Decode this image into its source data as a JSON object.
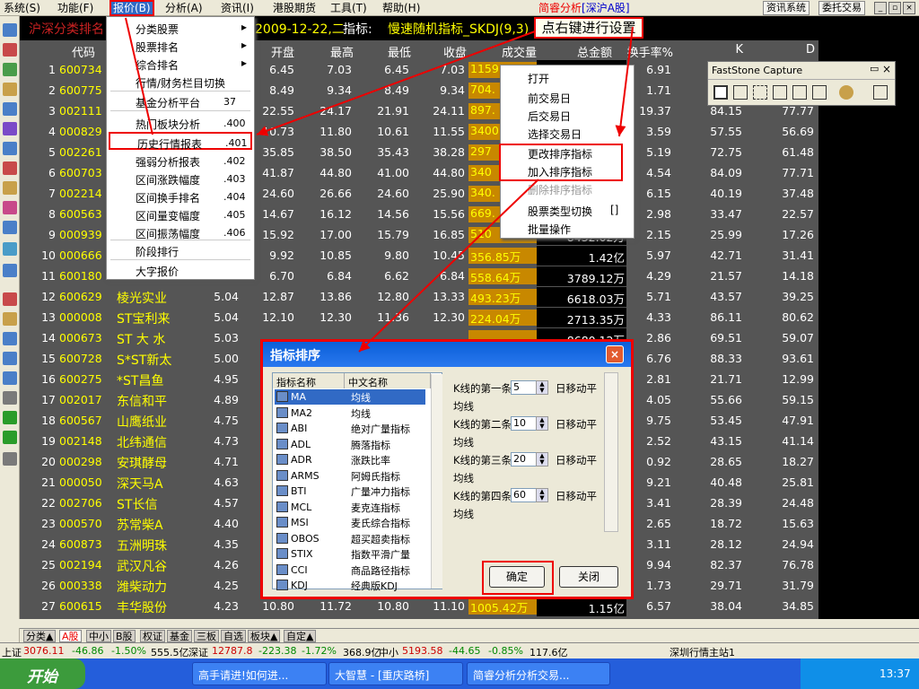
{
  "menubar": {
    "items": [
      "系统(S)",
      "功能(F)",
      "报价(B)",
      "分析(A)",
      "资讯(I)",
      "港股期货",
      "工具(T)",
      "帮助(H)"
    ],
    "brand": "简睿分析",
    "market": "[深沪A股]",
    "btn_info": "资讯系统",
    "btn_trade": "委托交易"
  },
  "titlebar": {
    "left": "沪深分类排名",
    "date": "2009-12-22,二",
    "ind_label": "指标:",
    "ind_name": "慢速随机指标_SKDJ(9,3)",
    "right_click": "点右键进行设置"
  },
  "table": {
    "headers": {
      "code": "代码",
      "open": "开盘",
      "high": "最高",
      "low": "最低",
      "close": "收盘",
      "vol": "成交量",
      "amt": "总金额",
      "tr": "换手率%",
      "k": "K",
      "d": "D"
    },
    "rows": [
      [
        "1",
        "600734",
        "",
        "",
        "6.45",
        "7.03",
        "6.45",
        "7.03",
        "1159.",
        "",
        "6.91",
        "",
        ""
      ],
      [
        "2",
        "600775",
        "",
        "",
        "8.49",
        "9.34",
        "8.49",
        "9.34",
        "704.",
        "",
        "1.71",
        "",
        ""
      ],
      [
        "3",
        "002111",
        "",
        "",
        "22.55",
        "24.17",
        "21.91",
        "24.11",
        "897.",
        "",
        "19.37",
        "84.15",
        "77.77"
      ],
      [
        "4",
        "000829",
        "",
        "",
        "10.73",
        "11.80",
        "10.61",
        "11.55",
        "3400.",
        "",
        "3.59",
        "57.55",
        "56.69"
      ],
      [
        "5",
        "002261",
        "",
        "",
        "35.85",
        "38.50",
        "35.43",
        "38.28",
        "297",
        "",
        "5.19",
        "72.75",
        "61.48"
      ],
      [
        "6",
        "600703",
        "",
        "",
        "41.87",
        "44.80",
        "41.00",
        "44.80",
        "340",
        "",
        "4.54",
        "84.09",
        "77.71"
      ],
      [
        "7",
        "002214",
        "",
        "",
        "24.60",
        "26.66",
        "24.60",
        "25.90",
        "340.",
        "",
        "6.15",
        "40.19",
        "37.48"
      ],
      [
        "8",
        "600563",
        "",
        "",
        "14.67",
        "16.12",
        "14.56",
        "15.56",
        "669.",
        "",
        "2.98",
        "33.47",
        "22.57"
      ],
      [
        "9",
        "000939",
        "",
        "",
        "15.92",
        "17.00",
        "15.79",
        "16.85",
        "510",
        "8432.02万",
        "2.15",
        "25.99",
        "17.26"
      ],
      [
        "10",
        "000666",
        "",
        "",
        "9.92",
        "10.85",
        "9.80",
        "10.45",
        "356.85万",
        "1.42亿",
        "5.97",
        "42.71",
        "31.41"
      ],
      [
        "11",
        "600180",
        "",
        "",
        "6.70",
        "6.84",
        "6.62",
        "6.84",
        "558.64万",
        "3789.12万",
        "4.29",
        "21.57",
        "14.18"
      ],
      [
        "12",
        "600629",
        "棱光实业",
        "5.04",
        "12.87",
        "13.86",
        "12.80",
        "13.33",
        "493.23万",
        "6618.03万",
        "5.71",
        "43.57",
        "39.25"
      ],
      [
        "13",
        "000008",
        "ST宝利来",
        "5.04",
        "12.10",
        "12.30",
        "11.36",
        "12.30",
        "224.04万",
        "2713.35万",
        "4.33",
        "86.11",
        "80.62"
      ],
      [
        "14",
        "000673",
        "ST 大 水",
        "5.03",
        "",
        "",
        "",
        "",
        "",
        "8680.12万",
        "2.86",
        "69.51",
        "59.07"
      ],
      [
        "15",
        "600728",
        "S*ST新太",
        "5.00",
        "",
        "",
        "",
        "",
        "",
        "",
        "6.76",
        "88.33",
        "93.61"
      ],
      [
        "16",
        "600275",
        "*ST昌鱼",
        "4.95",
        "",
        "",
        "",
        "",
        "",
        "",
        "2.81",
        "21.71",
        "12.99"
      ],
      [
        "17",
        "002017",
        "东信和平",
        "4.89",
        "",
        "",
        "",
        "",
        "",
        "",
        "4.05",
        "55.66",
        "59.15"
      ],
      [
        "18",
        "600567",
        "山鹰纸业",
        "4.75",
        "",
        "",
        "",
        "",
        "",
        "",
        "9.75",
        "53.45",
        "47.91"
      ],
      [
        "19",
        "002148",
        "北纬通信",
        "4.73",
        "",
        "",
        "",
        "",
        "",
        "",
        "2.52",
        "43.15",
        "41.14"
      ],
      [
        "20",
        "000298",
        "安琪酵母",
        "4.71",
        "",
        "",
        "",
        "",
        "",
        "",
        "0.92",
        "28.65",
        "18.27"
      ],
      [
        "21",
        "000050",
        "深天马A",
        "4.63",
        "",
        "",
        "",
        "",
        "",
        "",
        "9.21",
        "40.48",
        "25.81"
      ],
      [
        "22",
        "002706",
        "ST长信",
        "4.57",
        "",
        "",
        "",
        "",
        "",
        "",
        "3.41",
        "28.39",
        "24.48"
      ],
      [
        "23",
        "000570",
        "苏常柴A",
        "4.40",
        "",
        "",
        "",
        "",
        "",
        "",
        "2.65",
        "18.72",
        "15.63"
      ],
      [
        "24",
        "600873",
        "五洲明珠",
        "4.35",
        "",
        "",
        "",
        "",
        "",
        "",
        "3.11",
        "28.12",
        "24.94"
      ],
      [
        "25",
        "002194",
        "武汉凡谷",
        "4.26",
        "",
        "",
        "",
        "",
        "",
        "",
        "9.94",
        "82.37",
        "76.78"
      ],
      [
        "26",
        "000338",
        "潍柴动力",
        "4.25",
        "",
        "",
        "",
        "",
        "",
        "",
        "1.73",
        "29.71",
        "31.79"
      ],
      [
        "27",
        "600615",
        "丰华股份",
        "4.23",
        "10.80",
        "11.72",
        "10.80",
        "11.10",
        "1005.42万",
        "1.15亿",
        "6.57",
        "38.04",
        "34.85"
      ]
    ]
  },
  "report_menu": [
    {
      "label": "分类股票",
      "sc": "",
      "arr": "▸"
    },
    {
      "label": "股票排名",
      "sc": "",
      "arr": "▸"
    },
    {
      "label": "综合排名",
      "sc": "",
      "arr": "▸"
    },
    {
      "label": "行情/财务栏目切换",
      "sc": "",
      "arr": ""
    },
    {
      "label": "基金分析平台",
      "sc": "37",
      "arr": ""
    },
    {
      "label": "热门板块分析",
      "sc": ".400",
      "arr": ""
    },
    {
      "label": "历史行情报表",
      "sc": ".401",
      "arr": ""
    },
    {
      "label": "强弱分析报表",
      "sc": ".402",
      "arr": ""
    },
    {
      "label": "区间涨跌幅度",
      "sc": ".403",
      "arr": ""
    },
    {
      "label": "区间换手排名",
      "sc": ".404",
      "arr": ""
    },
    {
      "label": "区间量变幅度",
      "sc": ".405",
      "arr": ""
    },
    {
      "label": "区间振荡幅度",
      "sc": ".406",
      "arr": ""
    },
    {
      "label": "阶段排行",
      "sc": "",
      "arr": ""
    },
    {
      "label": "大字报价",
      "sc": "",
      "arr": ""
    }
  ],
  "context_menu": [
    {
      "label": "打开",
      "sc": ""
    },
    {
      "label": "前交易日",
      "sc": ""
    },
    {
      "label": "后交易日",
      "sc": ""
    },
    {
      "label": "选择交易日",
      "sc": ""
    },
    {
      "label": "更改排序指标",
      "sc": ""
    },
    {
      "label": "加入排序指标",
      "sc": ""
    },
    {
      "label": "删除排序指标",
      "sc": ""
    },
    {
      "label": "股票类型切换",
      "sc": "[]"
    },
    {
      "label": "批量操作",
      "sc": ""
    }
  ],
  "faststone": {
    "title": "FastStone Capture"
  },
  "dialog": {
    "title": "指标排序",
    "col_a": "指标名称",
    "col_b": "中文名称",
    "items": [
      [
        "MA",
        "均线"
      ],
      [
        "MA2",
        "均线"
      ],
      [
        "ABI",
        "绝对广量指标"
      ],
      [
        "ADL",
        "腾落指标"
      ],
      [
        "ADR",
        "涨跌比率"
      ],
      [
        "ARMS",
        "阿姆氏指标"
      ],
      [
        "BTI",
        "广量冲力指标"
      ],
      [
        "MCL",
        "麦克连指标"
      ],
      [
        "MSI",
        "麦氏综合指标"
      ],
      [
        "OBOS",
        "超买超卖指标"
      ],
      [
        "STIX",
        "指数平滑广量"
      ],
      [
        "CCI",
        "商品路径指标"
      ],
      [
        "KDJ",
        "经典版KDJ"
      ]
    ],
    "params": [
      {
        "label": "K线的第一条",
        "value": "5",
        "unit": "日移动平",
        "cont": "均线"
      },
      {
        "label": "K线的第二条",
        "value": "10",
        "unit": "日移动平",
        "cont": "均线"
      },
      {
        "label": "K线的第三条",
        "value": "20",
        "unit": "日移动平",
        "cont": "均线"
      },
      {
        "label": "K线的第四条",
        "value": "60",
        "unit": "日移动平",
        "cont": "均线"
      }
    ],
    "ok": "确定",
    "close": "关闭"
  },
  "tabs": [
    "分类▲",
    "A股",
    "中小",
    "B股",
    "权证",
    "基金",
    "三板",
    "自选",
    "板块▲",
    "自定▲"
  ],
  "status": {
    "sh": "上证",
    "sh_idx": "3076.11",
    "sh_chg": "-46.86",
    "sh_pct": "-1.50%",
    "sh_amt": "555.5亿",
    "sz": "深证",
    "sz_idx": "12787.8",
    "sz_chg": "-223.38",
    "sz_pct": "-1.72%",
    "sz_amt": "368.9亿",
    "zx": "中小",
    "zx_idx": "5193.58",
    "zx_chg": "-44.65",
    "zx_pct": "-0.85%",
    "zx_amt": "117.6亿",
    "server": "深圳行情主站1"
  },
  "taskbar": {
    "start": "开始",
    "tasks": [
      "高手请进!如何进...",
      "大智慧 - [重庆路桥]",
      "简睿分析分析交易..."
    ],
    "clock": "13:37"
  }
}
